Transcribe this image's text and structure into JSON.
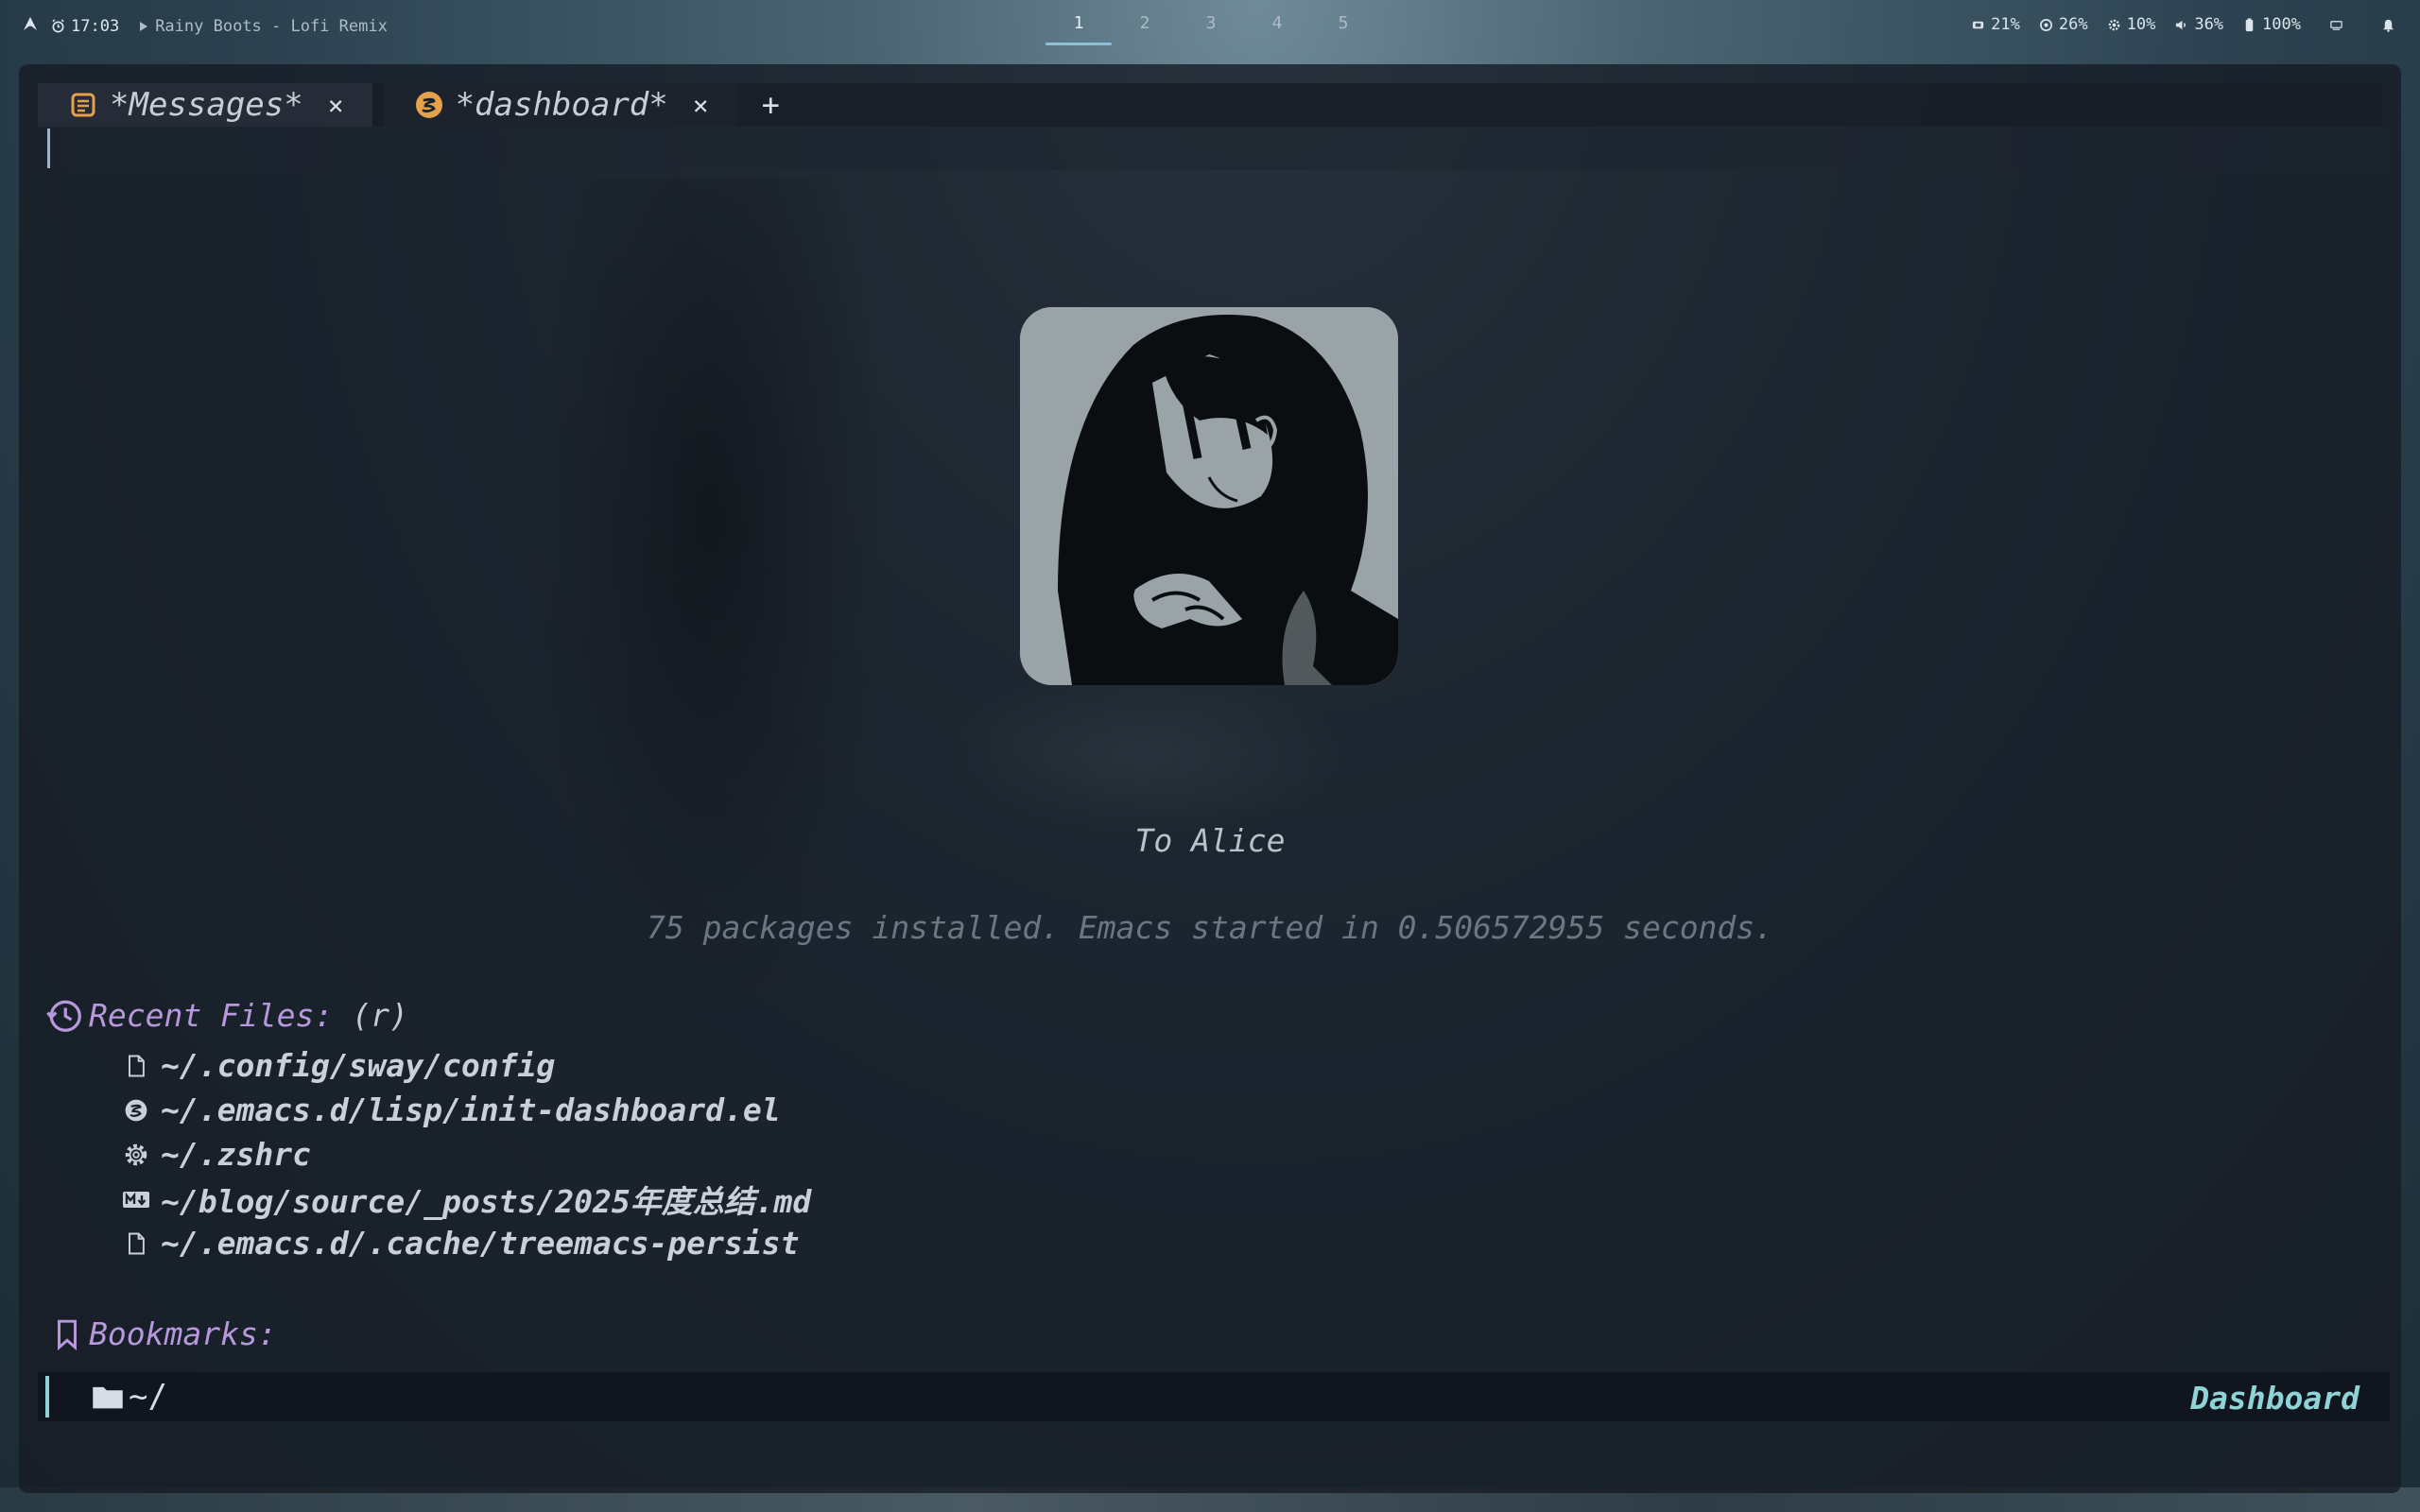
{
  "colors": {
    "accent": "#8fc1d6",
    "section_title": "#b898dc",
    "modeline_mode": "#8fd3d6",
    "tab_icon_orange": "#e5a24a"
  },
  "topbar": {
    "launcher_icon": "arch-icon",
    "clock": "17:03",
    "song": "Rainy Boots - Lofi Remix",
    "workspaces": [
      "1",
      "2",
      "3",
      "4",
      "5"
    ],
    "active_workspace": "1",
    "stats": {
      "memory": "21%",
      "cpu": "26%",
      "disk": "10%",
      "volume": "36%",
      "battery": "100%"
    }
  },
  "tabs": [
    {
      "label": "*Messages*",
      "icon": "scroll-icon",
      "close": "×"
    },
    {
      "label": "*dashboard*",
      "icon": "emacs-icon",
      "close": "×"
    }
  ],
  "new_tab": "+",
  "dashboard": {
    "tagline": "To Alice",
    "load_info": "75 packages installed. Emacs started in 0.506572955 seconds.",
    "recent": {
      "title": "Recent Files:",
      "key": "(r)",
      "files": [
        {
          "path": "~/.config/sway/config",
          "icon": "file-icon"
        },
        {
          "path": "~/.emacs.d/lisp/init-dashboard.el",
          "icon": "emacs-icon"
        },
        {
          "path": "~/.zshrc",
          "icon": "gear-icon"
        },
        {
          "path": "~/blog/source/_posts/2025年度总结.md",
          "icon": "markdown-icon"
        },
        {
          "path": "~/.emacs.d/.cache/treemacs-persist",
          "icon": "file-icon"
        }
      ]
    },
    "bookmarks": {
      "title": "Bookmarks:"
    }
  },
  "modeline": {
    "directory": "~/",
    "mode": "Dashboard"
  }
}
